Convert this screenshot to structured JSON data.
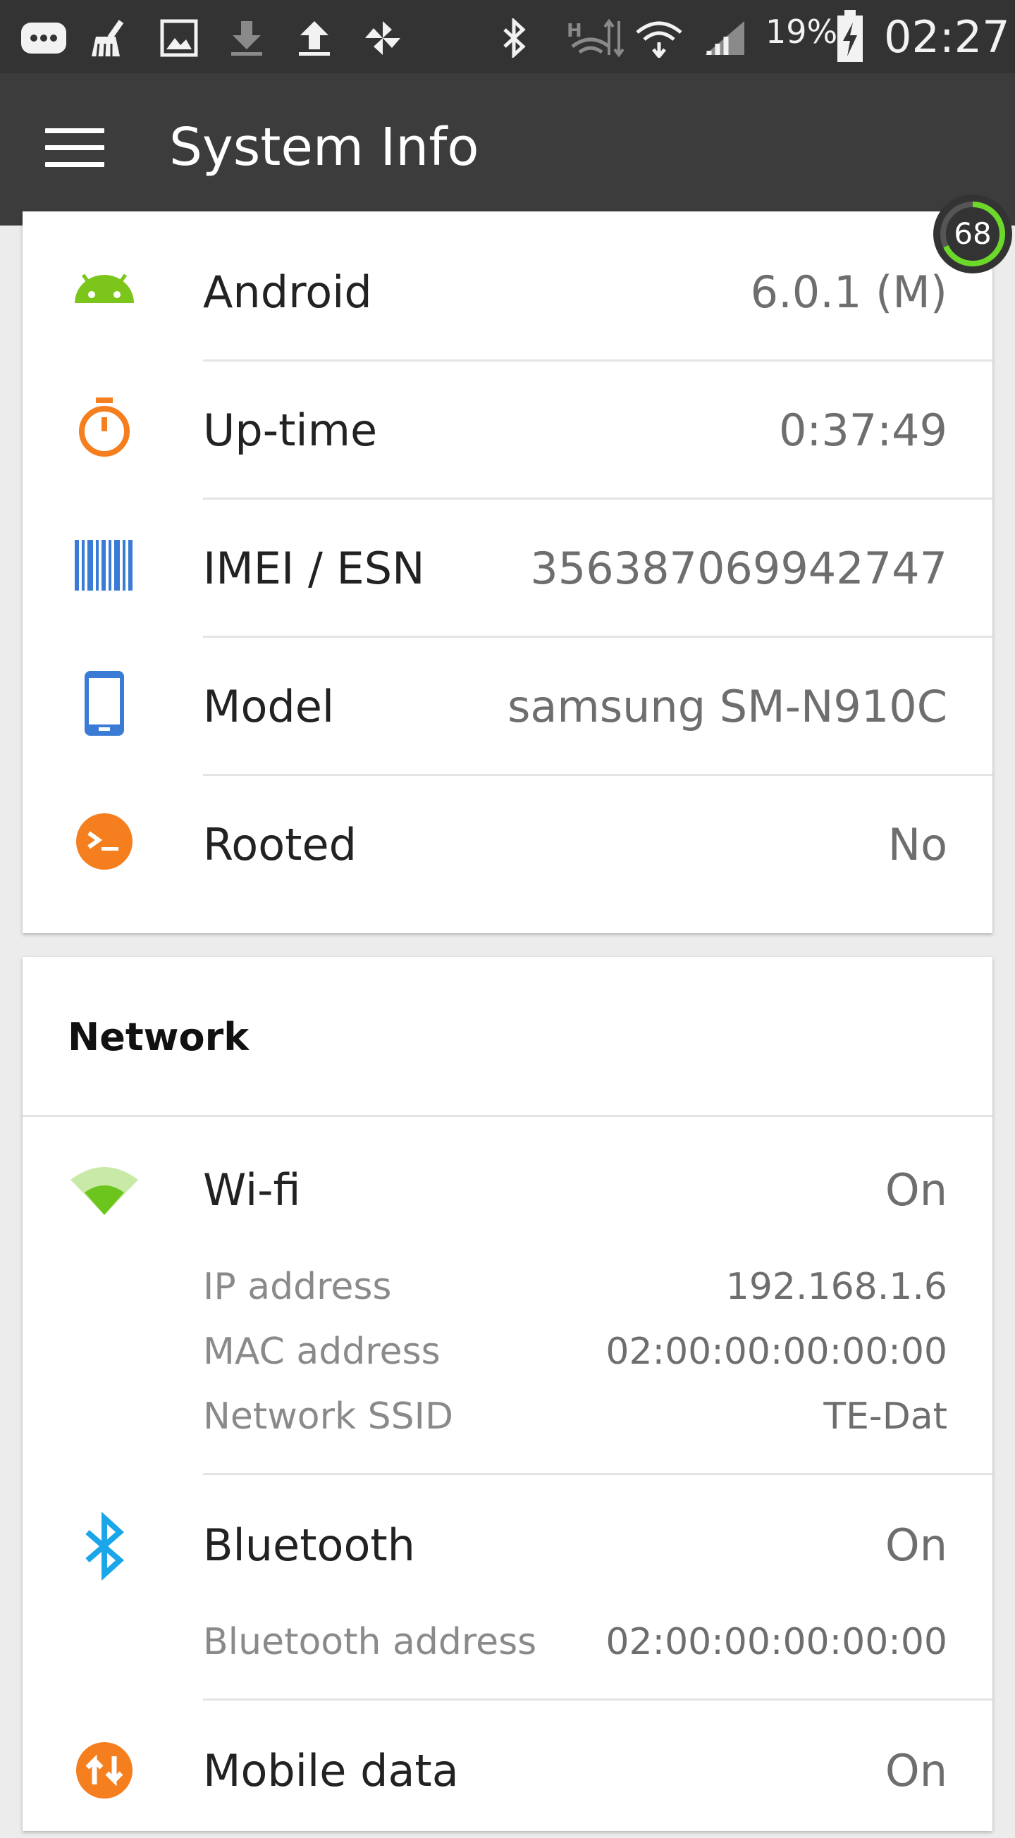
{
  "status_bar": {
    "battery_percent": "19%",
    "time": "02:27",
    "icons": [
      "message-icon",
      "cleaner-icon",
      "image-icon",
      "download-icon",
      "upload-icon",
      "pinwheel-icon",
      "bluetooth-icon",
      "hplus-data-icon",
      "wifi-icon",
      "hotspot-icon",
      "signal-icon",
      "battery-charging-icon"
    ]
  },
  "app_bar": {
    "title": "System Info",
    "menu_icon": "hamburger-menu-icon"
  },
  "badge": {
    "value": "68",
    "progress": 0.68
  },
  "system": {
    "rows": [
      {
        "label": "Android",
        "value": "6.0.1 (M)",
        "icon": "android-icon",
        "color": "#7cc61c"
      },
      {
        "label": "Up-time",
        "value": "0:37:49",
        "icon": "stopwatch-icon",
        "color": "#f57f1f"
      },
      {
        "label": "IMEI / ESN",
        "value": "356387069942747",
        "icon": "barcode-icon",
        "color": "#3a7bd5"
      },
      {
        "label": "Model",
        "value": "samsung SM-N910C",
        "icon": "phone-icon",
        "color": "#3a7bd5"
      },
      {
        "label": "Rooted",
        "value": "No",
        "icon": "terminal-icon",
        "color": "#f57f1f"
      }
    ]
  },
  "network": {
    "title": "Network",
    "wifi": {
      "label": "Wi-fi",
      "value": "On",
      "icon": "wifi-icon",
      "details": [
        {
          "label": "IP address",
          "value": "192.168.1.6"
        },
        {
          "label": "MAC address",
          "value": "02:00:00:00:00:00"
        },
        {
          "label": "Network SSID",
          "value": "TE-Dat"
        }
      ]
    },
    "bluetooth": {
      "label": "Bluetooth",
      "value": "On",
      "icon": "bluetooth-icon",
      "details": [
        {
          "label": "Bluetooth address",
          "value": "02:00:00:00:00:00"
        }
      ]
    },
    "mobile_data": {
      "label": "Mobile data",
      "value": "On",
      "icon": "mobile-data-icon"
    }
  }
}
